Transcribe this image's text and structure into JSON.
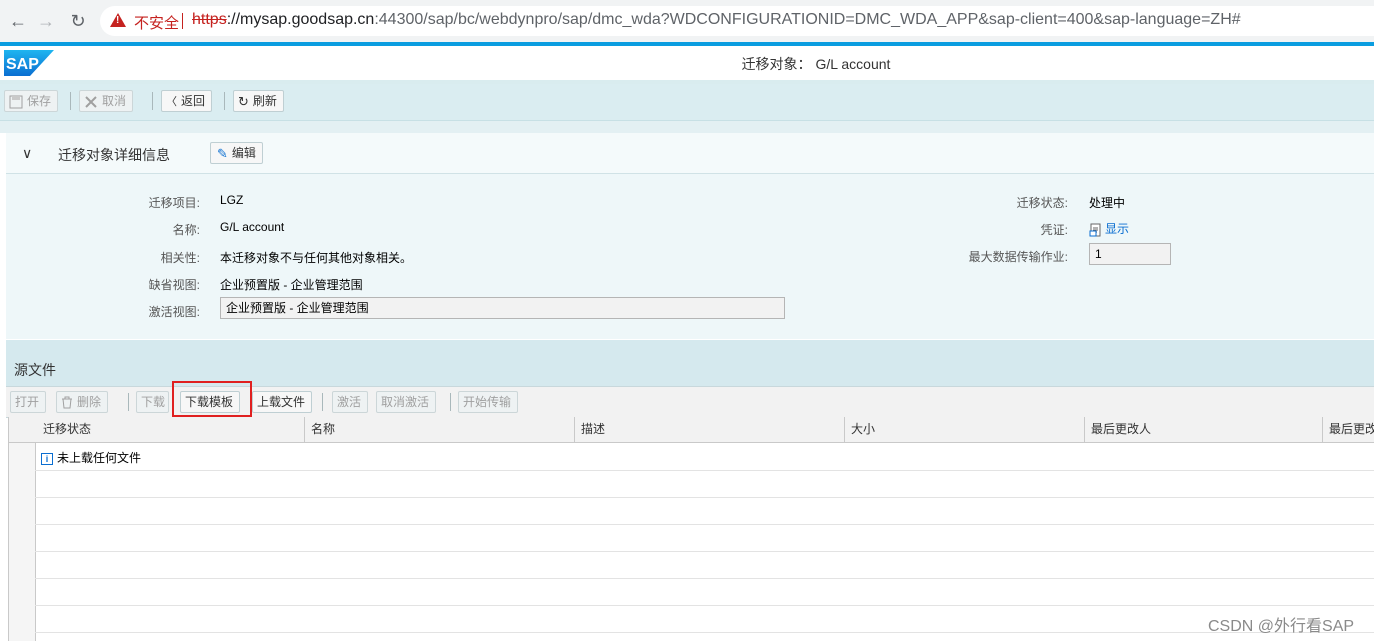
{
  "browser": {
    "back_glyph": "←",
    "forward_glyph": "→",
    "reload_glyph": "↻",
    "insecure_label": "不安全",
    "url_scheme": "https",
    "url_host": "://mysap.goodsap.cn",
    "url_rest": ":44300/sap/bc/webdynpro/sap/dmc_wda?WDCONFIGURATIONID=DMC_WDA_APP&sap-client=400&sap-language=ZH#"
  },
  "header": {
    "title": "迁移对象： G/L account"
  },
  "toolbar": {
    "save": "保存",
    "cancel": "取消",
    "back": "返回",
    "refresh": "刷新"
  },
  "details": {
    "section_title": "迁移对象详细信息",
    "edit": "编辑",
    "left": [
      {
        "label": "迁移项目:",
        "value": "LGZ"
      },
      {
        "label": "名称:",
        "value": "G/L account"
      },
      {
        "label": "相关性:",
        "value": "本迁移对象不与任何其他对象相关。"
      },
      {
        "label": "缺省视图:",
        "value": "企业预置版 - 企业管理范围"
      },
      {
        "label": "激活视图:",
        "value": "企业预置版 - 企业管理范围"
      }
    ],
    "right": [
      {
        "label": "迁移状态:",
        "value": "处理中"
      },
      {
        "label": "凭证:",
        "value": "显示"
      },
      {
        "label": "最大数据传输作业:",
        "value": "1"
      }
    ]
  },
  "source_files": {
    "title": "源文件",
    "buttons": {
      "open": "打开",
      "delete": "删除",
      "download": "下载",
      "download_template": "下载模板",
      "upload_file": "上载文件",
      "activate": "激活",
      "deactivate": "取消激活",
      "start_transfer": "开始传输"
    },
    "columns": [
      "迁移状态",
      "名称",
      "描述",
      "大小",
      "最后更改人",
      "最后更改"
    ],
    "empty_message": "未上载任何文件"
  },
  "watermark": "CSDN @外行看SAP",
  "colors": {
    "sap_blue": "#0a9de0",
    "toolbar_bg": "#daedf1",
    "highlight": "#e02020",
    "insecure_red": "#c5221f"
  }
}
